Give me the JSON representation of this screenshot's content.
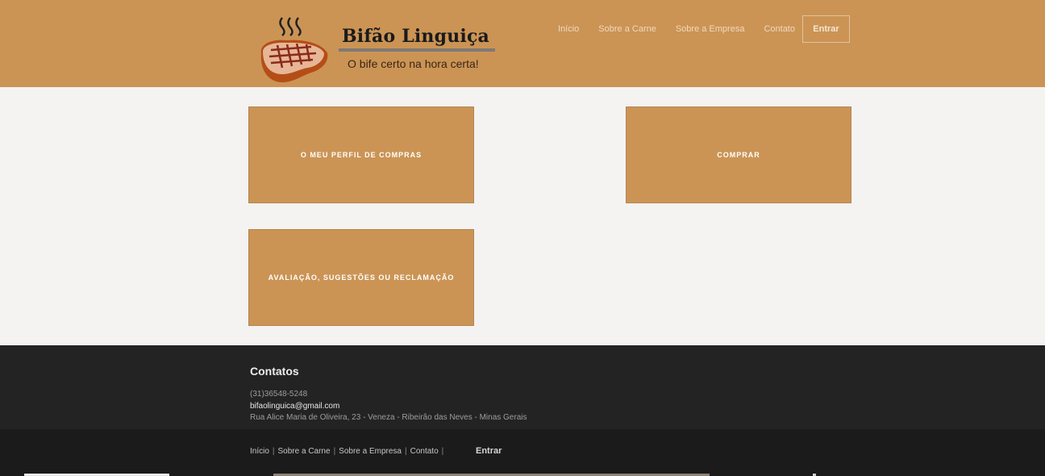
{
  "brand": {
    "name": "Bifão Linguiça",
    "slogan": "O bife certo na hora certa!"
  },
  "nav": {
    "items": [
      "Início",
      "Sobre a Carne",
      "Sobre a Empresa",
      "Contato"
    ],
    "login_label": "Entrar"
  },
  "tiles": [
    "O MEU PERFIL DE COMPRAS",
    "COMPRAR",
    "AVALIAÇÃO, SUGESTÕES OU RECLAMAÇÃO"
  ],
  "footer": {
    "title": "Contatos",
    "phone": "(31)36548-5248",
    "email": "bifaolinguica@gmail.com",
    "address": "Rua Alice Maria de Oliveira, 23 - Veneza - Ribeirão das Neves - Minas Gerais",
    "links": [
      "Início",
      "Sobre a Carne",
      "Sobre a Empresa",
      "Contato"
    ],
    "login_label": "Entrar"
  },
  "colors": {
    "brand": "#cb9455",
    "footer": "#232323",
    "bottom_bar": "#1b1b1b",
    "page_bg": "#f4f3f1"
  },
  "icons": [
    "steak-logo-icon"
  ]
}
